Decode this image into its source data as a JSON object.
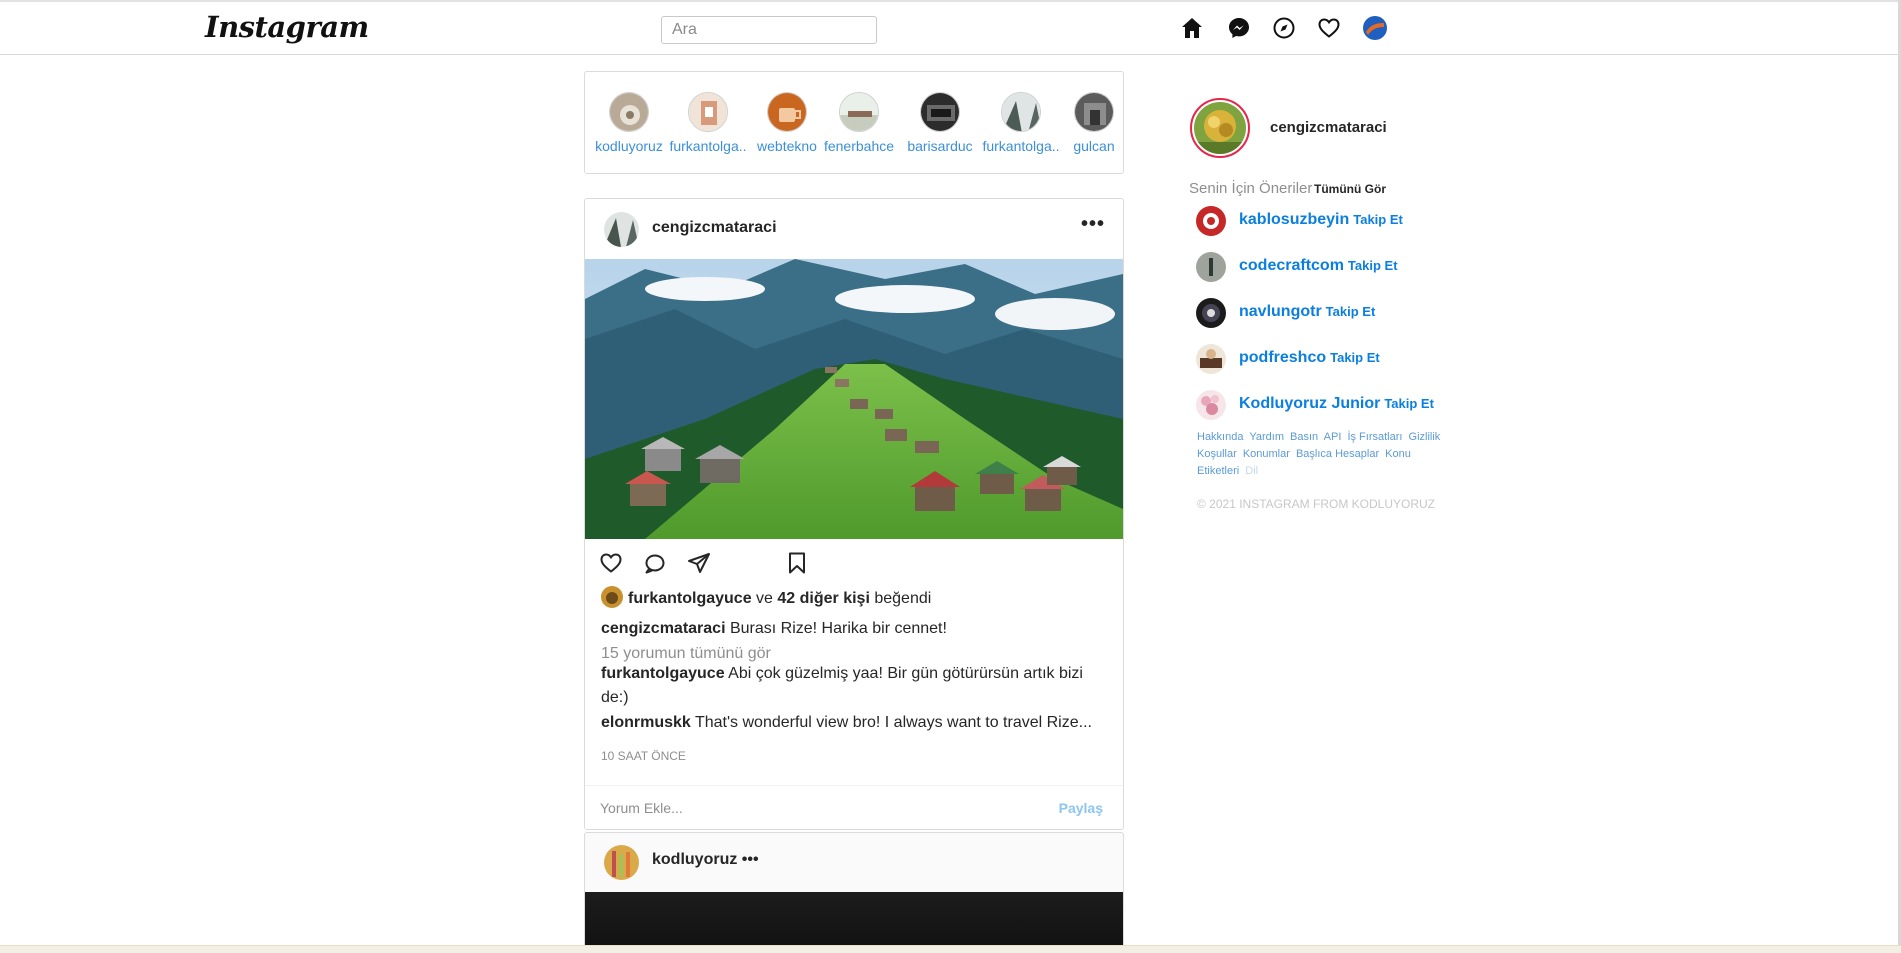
{
  "app": {
    "logo_text": "Instagram",
    "colors": {
      "link_blue": "#0b7fe0",
      "story_blue": "#3b8fd9",
      "ring_red": "#e8254a",
      "muted": "#8e8e8e",
      "border": "#dbdbdb"
    }
  },
  "nav": {
    "search_placeholder": "Ara",
    "icons": [
      "home-icon",
      "messenger-icon",
      "explore-compass-icon",
      "heart-icon",
      "profile-avatar-icon"
    ]
  },
  "stories": [
    {
      "name": "kodluyoruz"
    },
    {
      "name": "furkantolga.."
    },
    {
      "name": "webtekno"
    },
    {
      "name": "fenerbahce"
    },
    {
      "name": "barisarduc"
    },
    {
      "name": "furkantolga.."
    },
    {
      "name": "gulcan"
    }
  ],
  "post": {
    "username": "cengizcmataraci",
    "more_icon": "more-dots-icon",
    "likes": {
      "user": "furkantolgayuce",
      "connector": "ve",
      "others": "42 diğer kişi",
      "suffix": "beğendi"
    },
    "caption": {
      "user": "cengizcmataraci",
      "text": "Burası Rize! Harika bir cennet!"
    },
    "view_all_comments": "15 yorumun tümünü gör",
    "comments": [
      {
        "user": "furkantolgayuce",
        "text": "Abi çok güzelmiş yaa! Bir gün götürürsün artık bizi de:)"
      },
      {
        "user": "elonrmuskk",
        "text": "That's wonderful view bro! I always want to travel Rize..."
      }
    ],
    "time": "10 SAAT ÖNCE",
    "comment_placeholder": "Yorum Ekle...",
    "share_label": "Paylaş"
  },
  "post2": {
    "username": "kodluyoruz",
    "dots": "•••"
  },
  "sidebar": {
    "username": "cengizcmataraci",
    "suggestions_title": "Senin İçin Öneriler",
    "see_all": "Tümünü Gör",
    "suggestions": [
      {
        "username": "kablosuzbeyin",
        "action": "Takip Et"
      },
      {
        "username": "codecraftcom",
        "action": "Takip Et"
      },
      {
        "username": "navlungotr",
        "action": "Takip Et"
      },
      {
        "username": "podfreshco",
        "action": "Takip Et"
      },
      {
        "username": "Kodluyoruz Junior",
        "action": "Takip Et"
      }
    ],
    "footer_links": [
      "Hakkında",
      "Yardım",
      "Basın",
      "API",
      "İş Fırsatları",
      "Gizlilik",
      "Koşullar",
      "Konumlar",
      "Başlıca Hesaplar",
      "Konu Etiketleri",
      "Dil"
    ],
    "copyright": "© 2021 INSTAGRAM FROM KODLUYORUZ"
  }
}
